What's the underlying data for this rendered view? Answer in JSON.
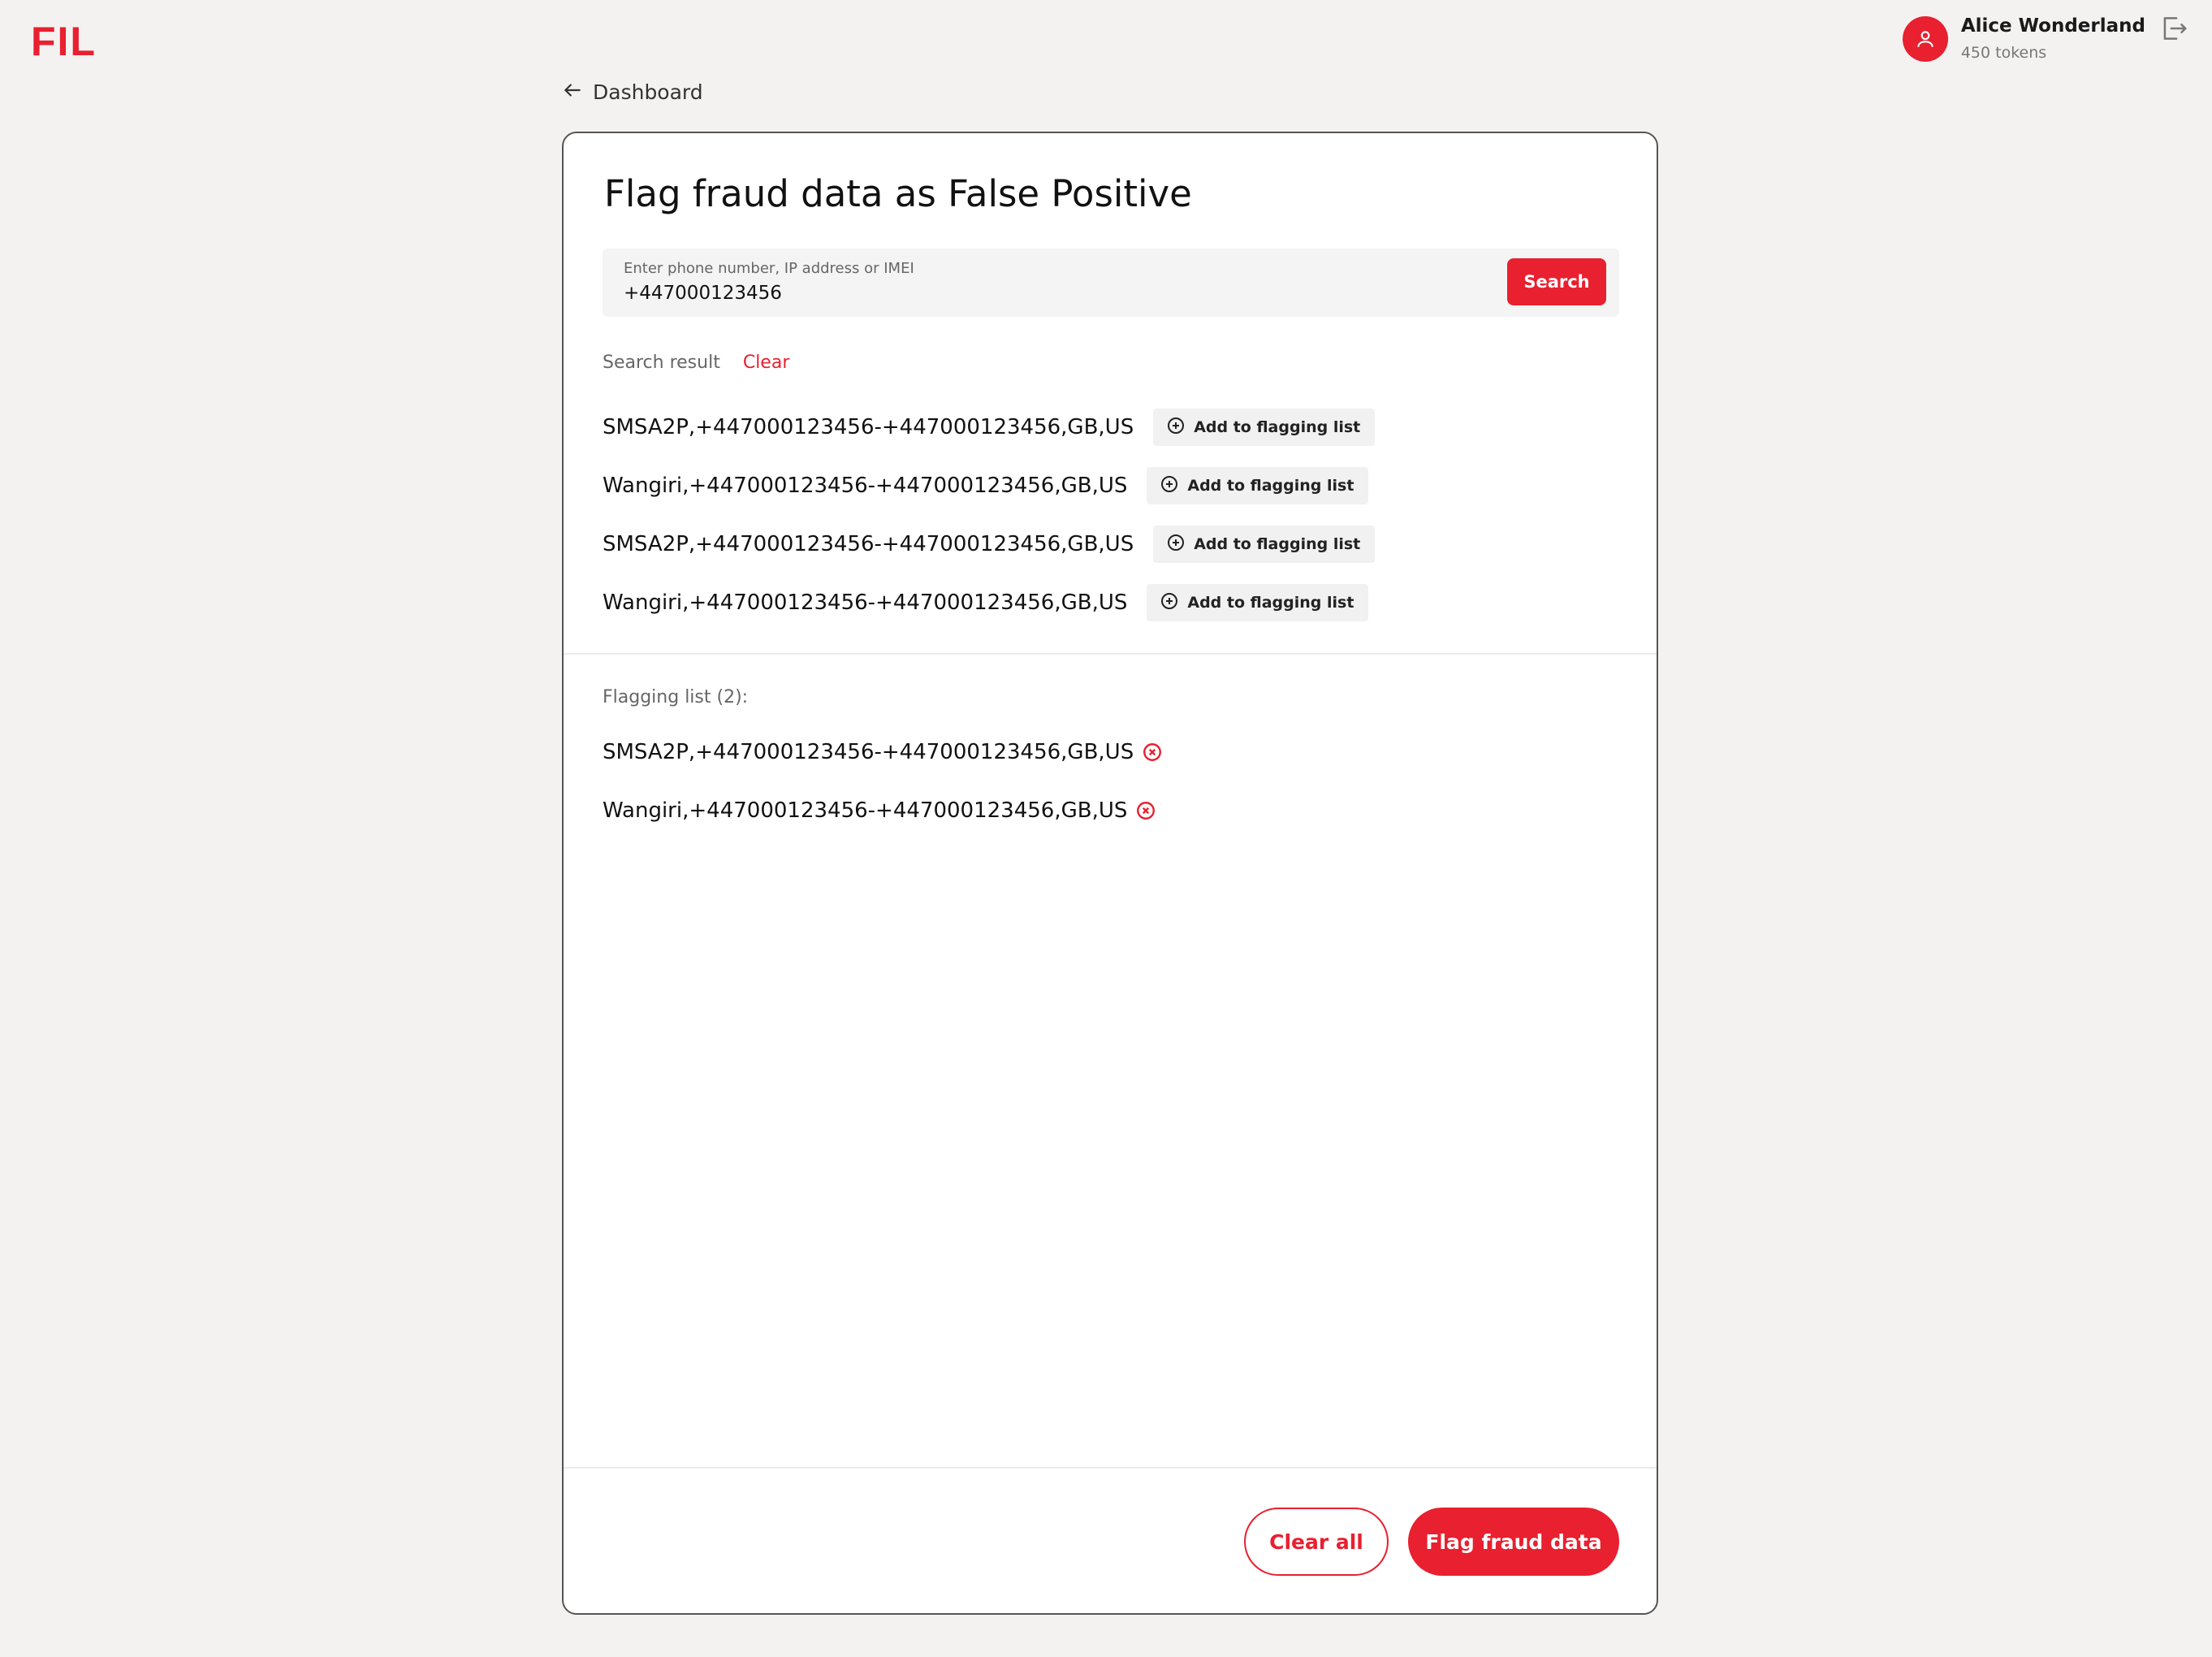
{
  "brand": {
    "logo_text": "FIL",
    "accent_color": "#e8202f"
  },
  "user": {
    "name": "Alice Wonderland",
    "tokens": "450 tokens",
    "avatar_icon": "user-icon",
    "logout_icon": "logout-icon"
  },
  "nav": {
    "back_label": "Dashboard",
    "back_icon": "arrow-left-icon"
  },
  "page": {
    "title": "Flag fraud data as False Positive"
  },
  "search": {
    "placeholder": "Enter phone number, IP address or IMEI",
    "value": "+447000123456",
    "button_label": "Search"
  },
  "results": {
    "label": "Search result",
    "clear_label": "Clear",
    "add_label": "Add to flagging list",
    "add_icon": "plus-circle-icon",
    "items": [
      "SMSA2P,+447000123456-+447000123456,GB,US",
      "Wangiri,+447000123456-+447000123456,GB,US",
      "SMSA2P,+447000123456-+447000123456,GB,US",
      "Wangiri,+447000123456-+447000123456,GB,US"
    ]
  },
  "flagging": {
    "label": "Flagging list (2):",
    "remove_icon": "close-circle-icon",
    "items": [
      "SMSA2P,+447000123456-+447000123456,GB,US",
      "Wangiri,+447000123456-+447000123456,GB,US"
    ]
  },
  "footer": {
    "clear_all_label": "Clear all",
    "flag_label": "Flag fraud data"
  }
}
